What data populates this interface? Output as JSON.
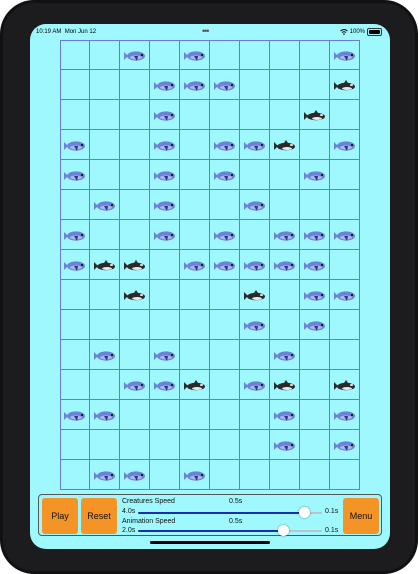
{
  "status_bar": {
    "time": "10:19 AM",
    "date": "Mon Jun 12",
    "battery": "100%"
  },
  "board": {
    "rows": 15,
    "cols": 10,
    "cells": [
      "..F.F....F",
      "...FFF...O",
      "...F....O.",
      "F..F.FFO.F",
      "F..F.F..F.",
      ".F.F..F...",
      "F..F.F.FFF",
      "FOO.FFFFF.",
      "..O...O.FF",
      "......F.F.",
      ".F.F...F..",
      "..FFO.FO.O",
      "FF.....F.F",
      ".......F.F",
      ".FF.F....."
    ],
    "legend": {
      "F": "fish",
      "O": "orca"
    }
  },
  "controls": {
    "play_label": "Play",
    "reset_label": "Reset",
    "menu_label": "Menu",
    "creatures_speed": {
      "label": "Creatures Speed",
      "current": "0.5s",
      "min": "4.0s",
      "max": "0.1s",
      "value_fraction": 0.9
    },
    "animation_speed": {
      "label": "Animation Speed",
      "current": "0.5s",
      "min": "2.0s",
      "max": "0.1s",
      "value_fraction": 0.79
    }
  },
  "colors": {
    "water": "#9ff8fd",
    "grid_line": "#6a7ad9",
    "button": "#f59426",
    "fish_body": "#6b82d8",
    "orca_body": "#2a2a2a",
    "slider_fill": "#1a2fb0"
  }
}
